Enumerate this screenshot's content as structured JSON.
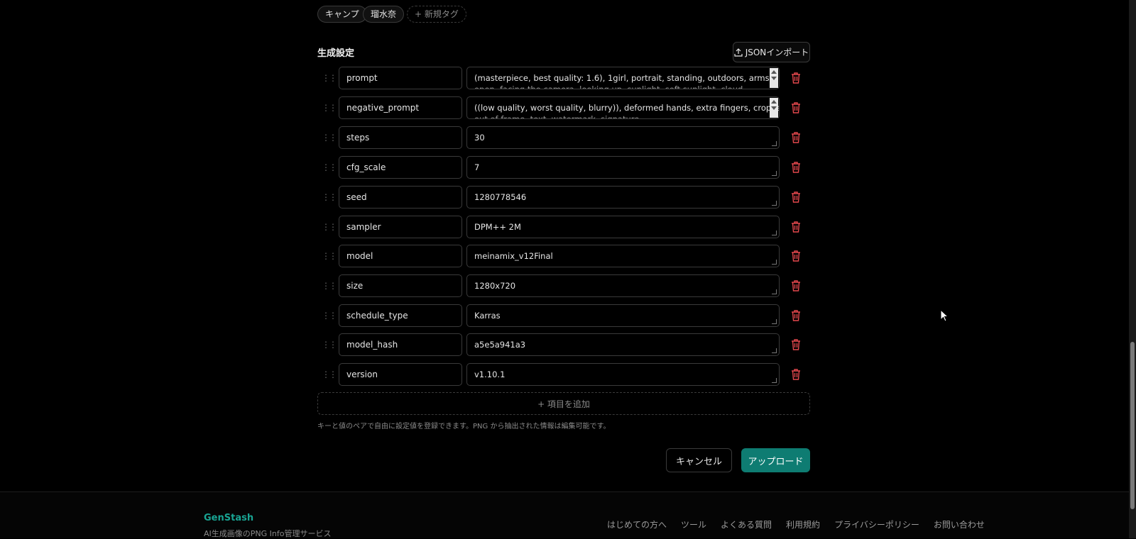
{
  "tags": {
    "items": [
      "キャンプ",
      "瑠水奈"
    ],
    "new_tag": "+ 新規タグ"
  },
  "settings": {
    "title": "生成設定",
    "import_label": "JSONインポート",
    "rows": [
      {
        "key": "prompt",
        "value": "(masterpiece, best quality: 1.6), 1girl, portrait, standing, outdoors,  arms wide",
        "value2": "open, facing the camera, looking up, sunlight, soft sunlight, cloud, ..."
      },
      {
        "key": "negative_prompt",
        "value": "((low quality, worst quality, blurry)), deformed hands, extra fingers,  cropped,",
        "value2": "out of frame, text, watermark, signature"
      },
      {
        "key": "steps",
        "value": "30"
      },
      {
        "key": "cfg_scale",
        "value": "7"
      },
      {
        "key": "seed",
        "value": "1280778546"
      },
      {
        "key": "sampler",
        "value": "DPM++ 2M"
      },
      {
        "key": "model",
        "value": "meinamix_v12Final"
      },
      {
        "key": "size",
        "value": "1280x720"
      },
      {
        "key": "schedule_type",
        "value": "Karras"
      },
      {
        "key": "model_hash",
        "value": "a5e5a941a3"
      },
      {
        "key": "version",
        "value": "v1.10.1"
      }
    ],
    "add_label": "+ 項目を追加",
    "hint": "キーと値のペアで自由に設定値を登録できます。PNG から抽出された情報は編集可能です。"
  },
  "actions": {
    "cancel_label": "キャンセル",
    "upload_label": "アップロード"
  },
  "footer": {
    "brand": "GenStash",
    "tagline": "AI生成画像のPNG Info管理サービス",
    "links": [
      "はじめての方へ",
      "ツール",
      "よくある質問",
      "利用規約",
      "プライバシーポリシー",
      "お問い合わせ"
    ]
  },
  "colors": {
    "accent": "#0e7c72",
    "brand": "#19a493",
    "danger": "#e5484d"
  },
  "icons": {
    "drag": "drag-handle-icon",
    "delete": "trash-icon",
    "import": "upload-icon",
    "cursor": "mouse-pointer-icon"
  }
}
